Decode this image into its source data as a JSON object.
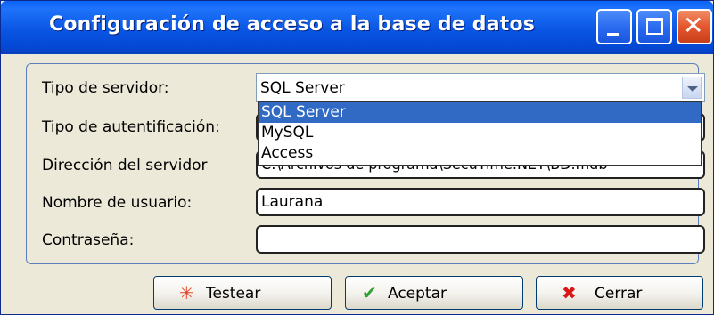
{
  "window": {
    "title": "Configuración de acceso a la base de datos",
    "controls": [
      "minimize",
      "maximize",
      "close"
    ]
  },
  "form": {
    "server_type": {
      "label": "Tipo de servidor:",
      "value": "SQL Server"
    },
    "auth_type": {
      "label": "Tipo de autentificación:",
      "value": ""
    },
    "server_address": {
      "label": "Dirección del servidor",
      "value": "C:\\Archivos de programa\\SecuTime.NET\\BD.mdb"
    },
    "username": {
      "label": "Nombre de usuario:",
      "value": "Laurana"
    },
    "password": {
      "label": "Contraseña:",
      "value": ""
    }
  },
  "dropdown": {
    "options": [
      "SQL Server",
      "MySQL",
      "Access"
    ],
    "selected": "SQL Server"
  },
  "buttons": {
    "test": {
      "label": "Testear",
      "icon": "star-burst-icon"
    },
    "accept": {
      "label": "Aceptar",
      "icon": "checkmark-icon"
    },
    "close": {
      "label": "Cerrar",
      "icon": "x-icon"
    }
  },
  "colors": {
    "titlebar": "#0a55e3",
    "selection": "#316ac5",
    "body": "#ece9d8"
  }
}
